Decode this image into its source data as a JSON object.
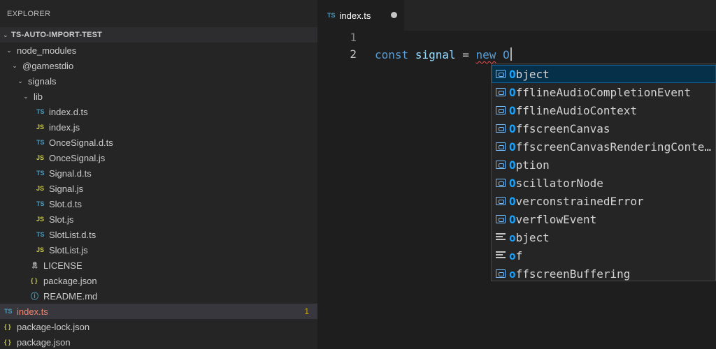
{
  "sidebar": {
    "title": "EXPLORER",
    "section": "TS-AUTO-IMPORT-TEST",
    "tree": [
      {
        "label": "node_modules",
        "kind": "folder",
        "depth": 0
      },
      {
        "label": "@gamestdio",
        "kind": "folder",
        "depth": 1
      },
      {
        "label": "signals",
        "kind": "folder",
        "depth": 2
      },
      {
        "label": "lib",
        "kind": "folder",
        "depth": 3
      },
      {
        "label": "index.d.ts",
        "kind": "ts",
        "depth": 4
      },
      {
        "label": "index.js",
        "kind": "js",
        "depth": 4
      },
      {
        "label": "OnceSignal.d.ts",
        "kind": "ts",
        "depth": 4
      },
      {
        "label": "OnceSignal.js",
        "kind": "js",
        "depth": 4
      },
      {
        "label": "Signal.d.ts",
        "kind": "ts",
        "depth": 4
      },
      {
        "label": "Signal.js",
        "kind": "js",
        "depth": 4
      },
      {
        "label": "Slot.d.ts",
        "kind": "ts",
        "depth": 4
      },
      {
        "label": "Slot.js",
        "kind": "js",
        "depth": 4
      },
      {
        "label": "SlotList.d.ts",
        "kind": "ts",
        "depth": 4
      },
      {
        "label": "SlotList.js",
        "kind": "js",
        "depth": 4
      },
      {
        "label": "LICENSE",
        "kind": "license",
        "depth": 3
      },
      {
        "label": "package.json",
        "kind": "json",
        "depth": 3
      },
      {
        "label": "README.md",
        "kind": "info",
        "depth": 3
      },
      {
        "label": "index.ts",
        "kind": "ts",
        "depth": 0,
        "selected": true,
        "error": true,
        "badge": "1"
      },
      {
        "label": "package-lock.json",
        "kind": "json",
        "depth": 0
      },
      {
        "label": "package.json",
        "kind": "json",
        "depth": 0
      }
    ]
  },
  "icons": {
    "ts": "TS",
    "js": "JS",
    "json": "{ }",
    "info": "ⓘ",
    "license": "🎗",
    "chevron": "⌄"
  },
  "tab": {
    "label": "index.ts",
    "icon": "TS"
  },
  "editor": {
    "lines": [
      "1",
      "2"
    ],
    "code": {
      "kw1": "const",
      "ident": "signal",
      "op": "=",
      "kw2": "new",
      "typed": "O"
    }
  },
  "suggest": {
    "items": [
      {
        "hl": "O",
        "rest": "bject",
        "icon": "var",
        "focused": true
      },
      {
        "hl": "O",
        "rest": "fflineAudioCompletionEvent",
        "icon": "var"
      },
      {
        "hl": "O",
        "rest": "fflineAudioContext",
        "icon": "var"
      },
      {
        "hl": "O",
        "rest": "ffscreenCanvas",
        "icon": "var"
      },
      {
        "hl": "O",
        "rest": "ffscreenCanvasRenderingConte…",
        "icon": "var"
      },
      {
        "hl": "O",
        "rest": "ption",
        "icon": "var"
      },
      {
        "hl": "O",
        "rest": "scillatorNode",
        "icon": "var"
      },
      {
        "hl": "O",
        "rest": "verconstrainedError",
        "icon": "var"
      },
      {
        "hl": "O",
        "rest": "verflowEvent",
        "icon": "var"
      },
      {
        "hl": "o",
        "rest": "bject",
        "icon": "text"
      },
      {
        "hl": "o",
        "rest": "f",
        "icon": "text"
      },
      {
        "hl": "o",
        "rest": "ffscreenBuffering",
        "icon": "var"
      }
    ]
  },
  "colors": {
    "sidebar_bg": "#252526",
    "editor_bg": "#1e1e1e",
    "ts_icon": "#519aba",
    "js_icon": "#cbcb41",
    "match_highlight": "#18a3ff",
    "error": "#f48771"
  }
}
